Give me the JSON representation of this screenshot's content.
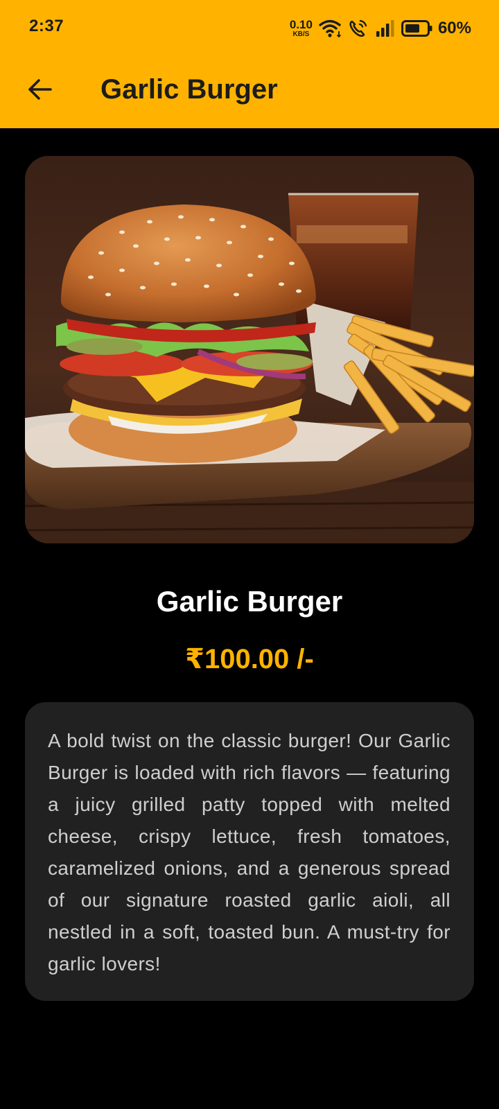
{
  "status_bar": {
    "time": "2:37",
    "net_speed_value": "0.10",
    "net_speed_unit": "KB/S",
    "battery_percent": "60%",
    "icons": [
      "wifi-icon",
      "volte-call-icon",
      "signal-icon",
      "battery-icon"
    ]
  },
  "app_bar": {
    "back_icon": "arrow-left-icon",
    "title": "Garlic Burger"
  },
  "product": {
    "image_alt": "burger-with-fries-and-cola",
    "name": "Garlic Burger",
    "price": "₹100.00 /-",
    "description": "A bold twist on the classic burger! Our Garlic Burger is loaded with rich flavors — featuring a juicy grilled patty topped with melted cheese, crispy lettuce, fresh tomatoes, caramelized onions, and a generous spread of our signature roasted garlic aioli, all nestled in a soft, toasted bun. A must-try for garlic lovers!"
  },
  "colors": {
    "accent": "#FFB300",
    "background": "#000000",
    "card": "#212121",
    "title_text": "#1c1c1c",
    "body_text": "#cfcfcf"
  }
}
